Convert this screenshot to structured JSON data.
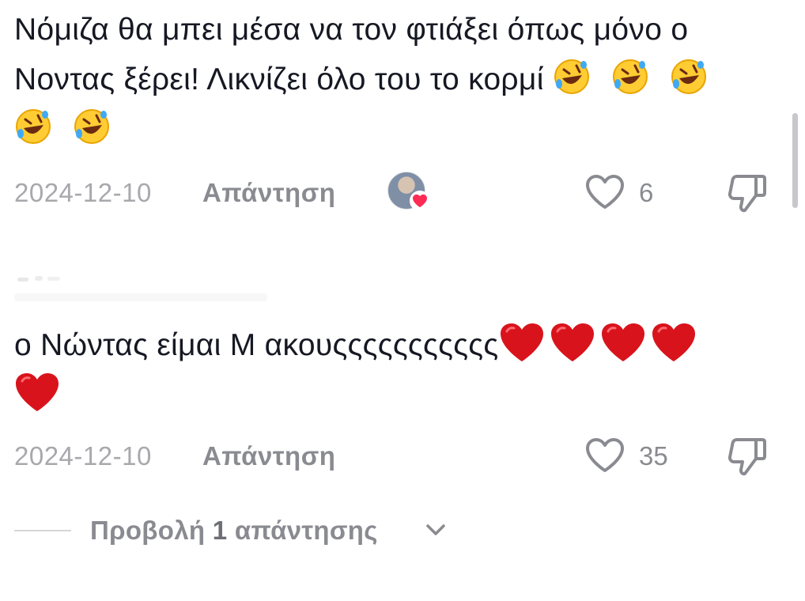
{
  "comments": [
    {
      "text": "Νόμιζα θα μπει μέσα να τον φτιάξει όπως μόνο ο Νοντας ξέρει! Λικνίζει όλο του το κορμί",
      "emoji_suffix": "rolling-on-floor-laughing x5",
      "date": "2024-12-10",
      "reply_label": "Απάντηση",
      "likes": "6",
      "creator_liked": true
    },
    {
      "text": "ο Νώντας είμαι Μ ακουςςςςςςςςςςς",
      "emoji_suffix": "red-heart x5",
      "date": "2024-12-10",
      "reply_label": "Απάντηση",
      "likes": "35",
      "creator_liked": false
    }
  ],
  "view_replies": {
    "prefix": "Προβολή ",
    "count": "1",
    "suffix": " απάντησης"
  },
  "colors": {
    "text": "#161823",
    "muted": "#8a8b91",
    "date": "#a8a8ad",
    "heart_red": "#fe2c55"
  },
  "icons": [
    "heart-outline-icon",
    "thumbs-down-icon",
    "chevron-down-icon",
    "heart-filled-icon"
  ]
}
